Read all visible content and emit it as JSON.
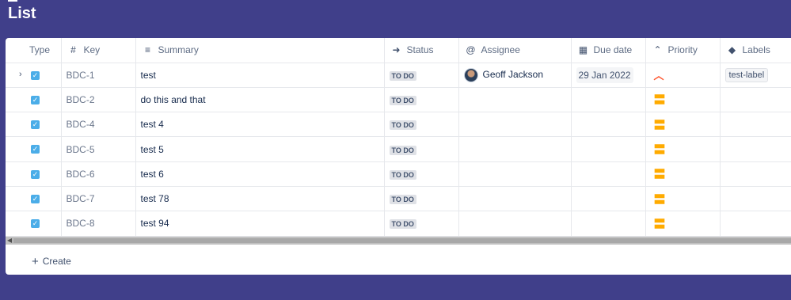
{
  "page": {
    "title": "List",
    "background_color": "#403f8a"
  },
  "columns": [
    {
      "label": "Type",
      "icon": ""
    },
    {
      "label": "Key",
      "icon": "hash-icon"
    },
    {
      "label": "Summary",
      "icon": "lines-icon"
    },
    {
      "label": "Status",
      "icon": "status-arrow-icon"
    },
    {
      "label": "Assignee",
      "icon": "at-icon"
    },
    {
      "label": "Due date",
      "icon": "calendar-icon"
    },
    {
      "label": "Priority",
      "icon": "chevron-up-circle-icon"
    },
    {
      "label": "Labels",
      "icon": "tag-icon"
    }
  ],
  "rows": [
    {
      "key": "BDC-1",
      "summary": "test",
      "status": "TO DO",
      "assignee": "Geoff Jackson",
      "due": "29 Jan 2022",
      "priority": "high",
      "label": "test-label",
      "expandable": true
    },
    {
      "key": "BDC-2",
      "summary": "do this and that",
      "status": "TO DO",
      "assignee": "",
      "due": "",
      "priority": "medium",
      "label": ""
    },
    {
      "key": "BDC-4",
      "summary": "test 4",
      "status": "TO DO",
      "assignee": "",
      "due": "",
      "priority": "medium",
      "label": ""
    },
    {
      "key": "BDC-5",
      "summary": "test 5",
      "status": "TO DO",
      "assignee": "",
      "due": "",
      "priority": "medium",
      "label": ""
    },
    {
      "key": "BDC-6",
      "summary": "test 6",
      "status": "TO DO",
      "assignee": "",
      "due": "",
      "priority": "medium",
      "label": ""
    },
    {
      "key": "BDC-7",
      "summary": "test 78",
      "status": "TO DO",
      "assignee": "",
      "due": "",
      "priority": "medium",
      "label": ""
    },
    {
      "key": "BDC-8",
      "summary": "test 94",
      "status": "TO DO",
      "assignee": "",
      "due": "",
      "priority": "medium",
      "label": ""
    }
  ],
  "footer": {
    "create_label": "Create"
  },
  "colors": {
    "checkbox": "#4bade8",
    "priority_medium": "#ffab00",
    "priority_high": "#ff5630"
  }
}
